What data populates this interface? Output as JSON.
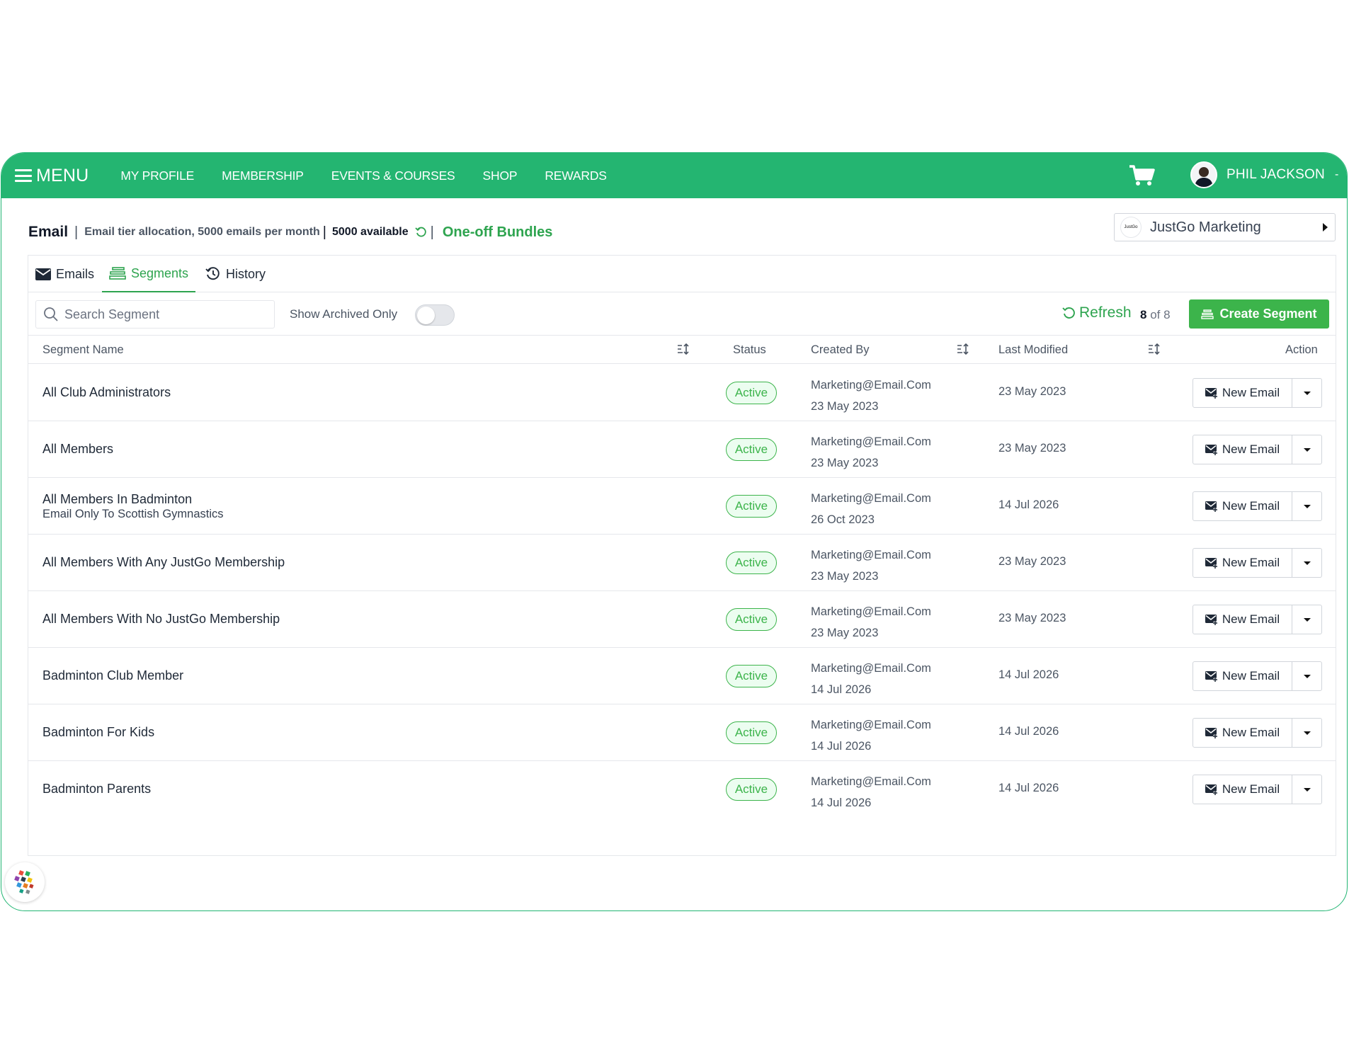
{
  "colors": {
    "brand": "#24b571",
    "accent": "#2ea44f",
    "button": "#3cb44b"
  },
  "nav": {
    "menu_label": "MENU",
    "items": [
      "MY PROFILE",
      "MEMBERSHIP",
      "EVENTS & COURSES",
      "SHOP",
      "REWARDS"
    ],
    "user_name": "PHIL JACKSON",
    "user_caret": "-"
  },
  "header": {
    "title": "Email",
    "separator": "|",
    "allocation": "Email tier allocation, 5000 emails per month",
    "available": "5000 available",
    "bundles": "One-off Bundles"
  },
  "org": {
    "logo_text": "JustGo",
    "name": "JustGo Marketing"
  },
  "tabs": [
    {
      "label": "Emails",
      "icon": "envelope-icon"
    },
    {
      "label": "Segments",
      "icon": "segments-icon"
    },
    {
      "label": "History",
      "icon": "history-icon"
    }
  ],
  "toolbar": {
    "search_placeholder": "Search Segment",
    "archived_label": "Show Archived Only",
    "refresh_label": "Refresh",
    "count_shown": "8",
    "count_of": "of 8",
    "create_label": "Create Segment"
  },
  "table": {
    "headers": {
      "name": "Segment Name",
      "status": "Status",
      "created_by": "Created By",
      "last_modified": "Last Modified",
      "action": "Action"
    },
    "action_label": "New Email",
    "rows": [
      {
        "name": "All Club Administrators",
        "sub": "",
        "status": "Active",
        "creator": "Marketing@Email.Com",
        "created": "23 May 2023",
        "modified": "23 May 2023"
      },
      {
        "name": "All Members",
        "sub": "",
        "status": "Active",
        "creator": "Marketing@Email.Com",
        "created": "23 May 2023",
        "modified": "23 May 2023"
      },
      {
        "name": "All Members In Badminton",
        "sub": "Email Only To Scottish Gymnastics",
        "status": "Active",
        "creator": "Marketing@Email.Com",
        "created": "26 Oct 2023",
        "modified": "14 Jul 2026"
      },
      {
        "name": "All Members With Any JustGo Membership",
        "sub": "",
        "status": "Active",
        "creator": "Marketing@Email.Com",
        "created": "23 May 2023",
        "modified": "23 May 2023"
      },
      {
        "name": "All Members With No JustGo Membership",
        "sub": "",
        "status": "Active",
        "creator": "Marketing@Email.Com",
        "created": "23 May 2023",
        "modified": "23 May 2023"
      },
      {
        "name": "Badminton Club Member",
        "sub": "",
        "status": "Active",
        "creator": "Marketing@Email.Com",
        "created": "14 Jul 2026",
        "modified": "14 Jul 2026"
      },
      {
        "name": "Badminton For Kids",
        "sub": "",
        "status": "Active",
        "creator": "Marketing@Email.Com",
        "created": "14 Jul 2026",
        "modified": "14 Jul 2026"
      },
      {
        "name": "Badminton Parents",
        "sub": "",
        "status": "Active",
        "creator": "Marketing@Email.Com",
        "created": "14 Jul 2026",
        "modified": "14 Jul 2026"
      }
    ]
  }
}
